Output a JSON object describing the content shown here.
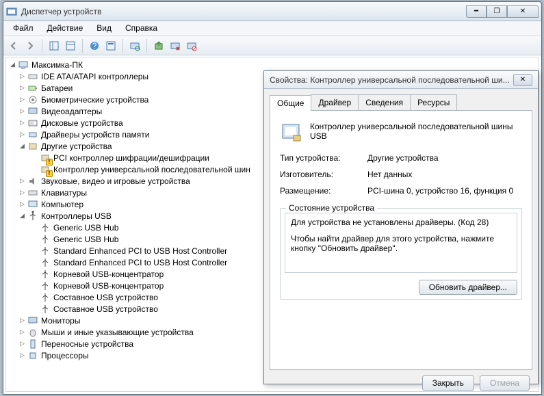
{
  "window": {
    "title": "Диспетчер устройств"
  },
  "menu": {
    "file": "Файл",
    "action": "Действие",
    "view": "Вид",
    "help": "Справка"
  },
  "tree": {
    "root": "Максимка-ПК",
    "ide": "IDE ATA/ATAPI контроллеры",
    "batteries": "Батареи",
    "biometric": "Биометрические устройства",
    "video": "Видеоадаптеры",
    "disk": "Дисковые устройства",
    "memdrivers": "Драйверы устройств памяти",
    "other": "Другие устройства",
    "other_pci": "PCI контроллер шифрации/дешифрации",
    "other_usb": "Контроллер универсальной последовательной шин",
    "sound": "Звуковые, видео и игровые устройства",
    "keyboards": "Клавиатуры",
    "computer": "Компьютер",
    "usb": "Контроллеры USB",
    "usb_hub1": "Generic USB Hub",
    "usb_hub2": "Generic USB Hub",
    "usb_ehci1": "Standard Enhanced PCI to USB Host Controller",
    "usb_ehci2": "Standard Enhanced PCI to USB Host Controller",
    "usb_root1": "Корневой USB-концентратор",
    "usb_root2": "Корневой USB-концентратор",
    "usb_comp1": "Составное USB устройство",
    "usb_comp2": "Составное USB устройство",
    "monitors": "Мониторы",
    "mice": "Мыши и иные указывающие устройства",
    "portable": "Переносные устройства",
    "cpu": "Процессоры"
  },
  "dialog": {
    "title": "Свойства: Контроллер универсальной последовательной ши...",
    "tab_general": "Общие",
    "tab_driver": "Драйвер",
    "tab_details": "Сведения",
    "tab_resources": "Ресурсы",
    "device_name": "Контроллер универсальной последовательной шины USB",
    "type_label": "Тип устройства:",
    "type_value": "Другие устройства",
    "mfr_label": "Изготовитель:",
    "mfr_value": "Нет данных",
    "loc_label": "Размещение:",
    "loc_value": "PCI-шина 0, устройство 16, функция 0",
    "status_legend": "Состояние устройства",
    "status_line1": "Для устройства не установлены драйверы. (Код 28)",
    "status_line2": "Чтобы найти драйвер для этого устройства, нажмите кнопку \"Обновить драйвер\".",
    "update_btn": "Обновить драйвер...",
    "close_btn": "Закрыть",
    "cancel_btn": "Отмена"
  }
}
